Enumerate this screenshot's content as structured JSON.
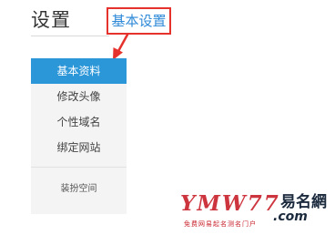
{
  "header": {
    "title": "设置"
  },
  "annotation": {
    "label": "基本设置",
    "box_color": "#e5322d",
    "label_color": "#2e8ad8"
  },
  "sidebar": {
    "accent": "#2b96d8",
    "items": [
      {
        "label": "基本资料",
        "active": true
      },
      {
        "label": "修改头像",
        "active": false
      },
      {
        "label": "个性域名",
        "active": false
      },
      {
        "label": "绑定网站",
        "active": false
      }
    ],
    "footer_item": {
      "label": "装扮空间"
    }
  },
  "watermark": {
    "brand": "YMW77",
    "name": "易名網",
    "domain": ".com",
    "tagline": "免费网易起名测名门户",
    "color": "#c8202a"
  }
}
